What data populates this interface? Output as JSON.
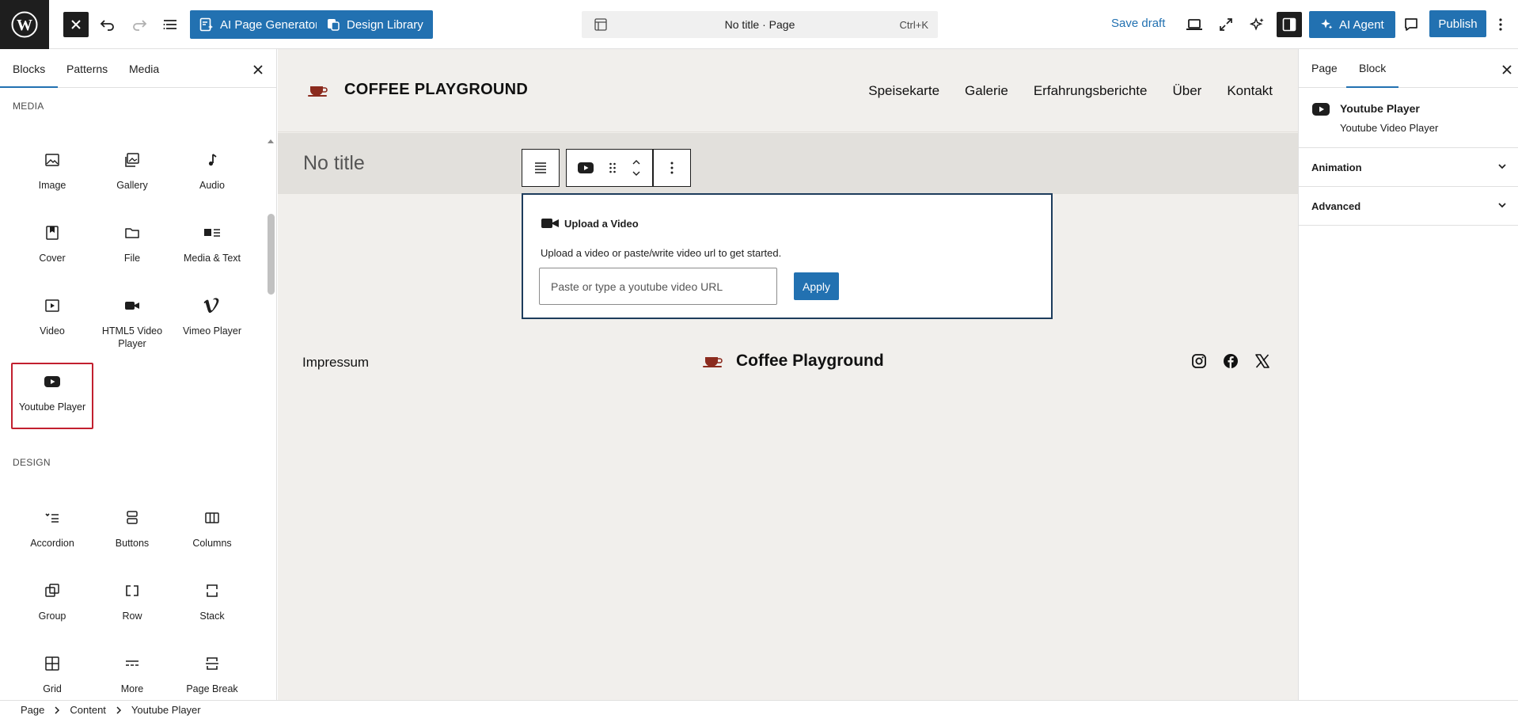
{
  "topbar": {
    "ai_page_generator": "AI Page Generator",
    "design_library": "Design Library",
    "document_title": "No title · Page",
    "shortcut": "Ctrl+K",
    "save_draft": "Save draft",
    "ai_agent": "AI Agent",
    "publish": "Publish"
  },
  "inserter": {
    "tabs": [
      "Blocks",
      "Patterns",
      "Media"
    ],
    "media_section": "MEDIA",
    "media_blocks": [
      "Image",
      "Gallery",
      "Audio",
      "Cover",
      "File",
      "Media & Text",
      "Video",
      "HTML5 Video Player",
      "Vimeo Player",
      "Youtube Player"
    ],
    "design_section": "DESIGN",
    "design_blocks": [
      "Accordion",
      "Buttons",
      "Columns",
      "Group",
      "Row",
      "Stack",
      "Grid",
      "More",
      "Page Break"
    ]
  },
  "canvas": {
    "site_title": "COFFEE PLAYGROUND",
    "nav": [
      "Speisekarte",
      "Galerie",
      "Erfahrungsberichte",
      "Über",
      "Kontakt"
    ],
    "page_title": "No title",
    "youtube_block": {
      "heading": "Upload a Video",
      "description": "Upload a video or paste/write video url to get started.",
      "placeholder": "Paste or type a youtube video URL",
      "apply": "Apply"
    },
    "footer": {
      "impressum": "Impressum",
      "brand": "Coffee Playground"
    }
  },
  "sidebar": {
    "tabs": [
      "Page",
      "Block"
    ],
    "block_title": "Youtube Player",
    "block_description": "Youtube Video Player",
    "panels": [
      "Animation",
      "Advanced"
    ]
  },
  "breadcrumb": [
    "Page",
    "Content",
    "Youtube Player"
  ],
  "colors": {
    "accent": "#2271b1",
    "canvas_bg": "#f1efec",
    "selection_outline": "#c21f2f",
    "coffee_cup": "#8b2b1e"
  }
}
